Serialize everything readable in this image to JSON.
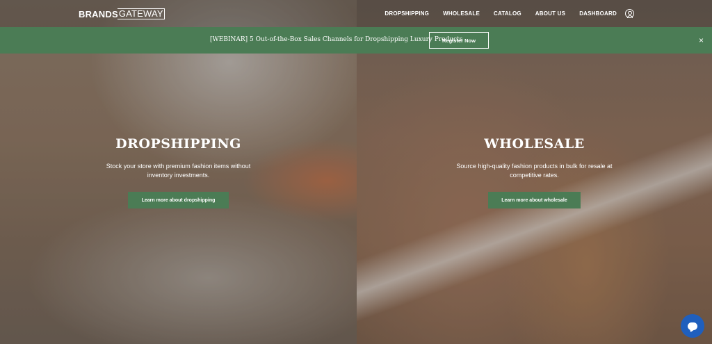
{
  "header": {
    "logo_bold": "BRANDS",
    "logo_light": "GATEWAY",
    "nav": [
      {
        "label": "DROPSHIPPING"
      },
      {
        "label": "WHOLESALE"
      },
      {
        "label": "CATALOG"
      },
      {
        "label": "ABOUT US"
      },
      {
        "label": "DASHBOARD"
      }
    ],
    "account_icon": "user-circle-icon"
  },
  "banner": {
    "text": "[WEBINAR] 5 Out-of-the-Box Sales Channels for Dropshipping Luxury Products",
    "button_label": "Register Now",
    "close_label": "×",
    "background_color": "#4b7c55"
  },
  "dropshipping": {
    "title": "DROPSHIPPING",
    "description": "Stock your store with premium fashion items without inventory investments.",
    "button_label": "Learn more about dropshipping"
  },
  "wholesale": {
    "title": "WHOLESALE",
    "description": "Source high-quality fashion products in bulk for resale at competitive rates.",
    "button_label": "Learn more about wholesale"
  },
  "chat": {
    "icon": "chat-bubble-icon",
    "color": "#1f5fbd"
  }
}
